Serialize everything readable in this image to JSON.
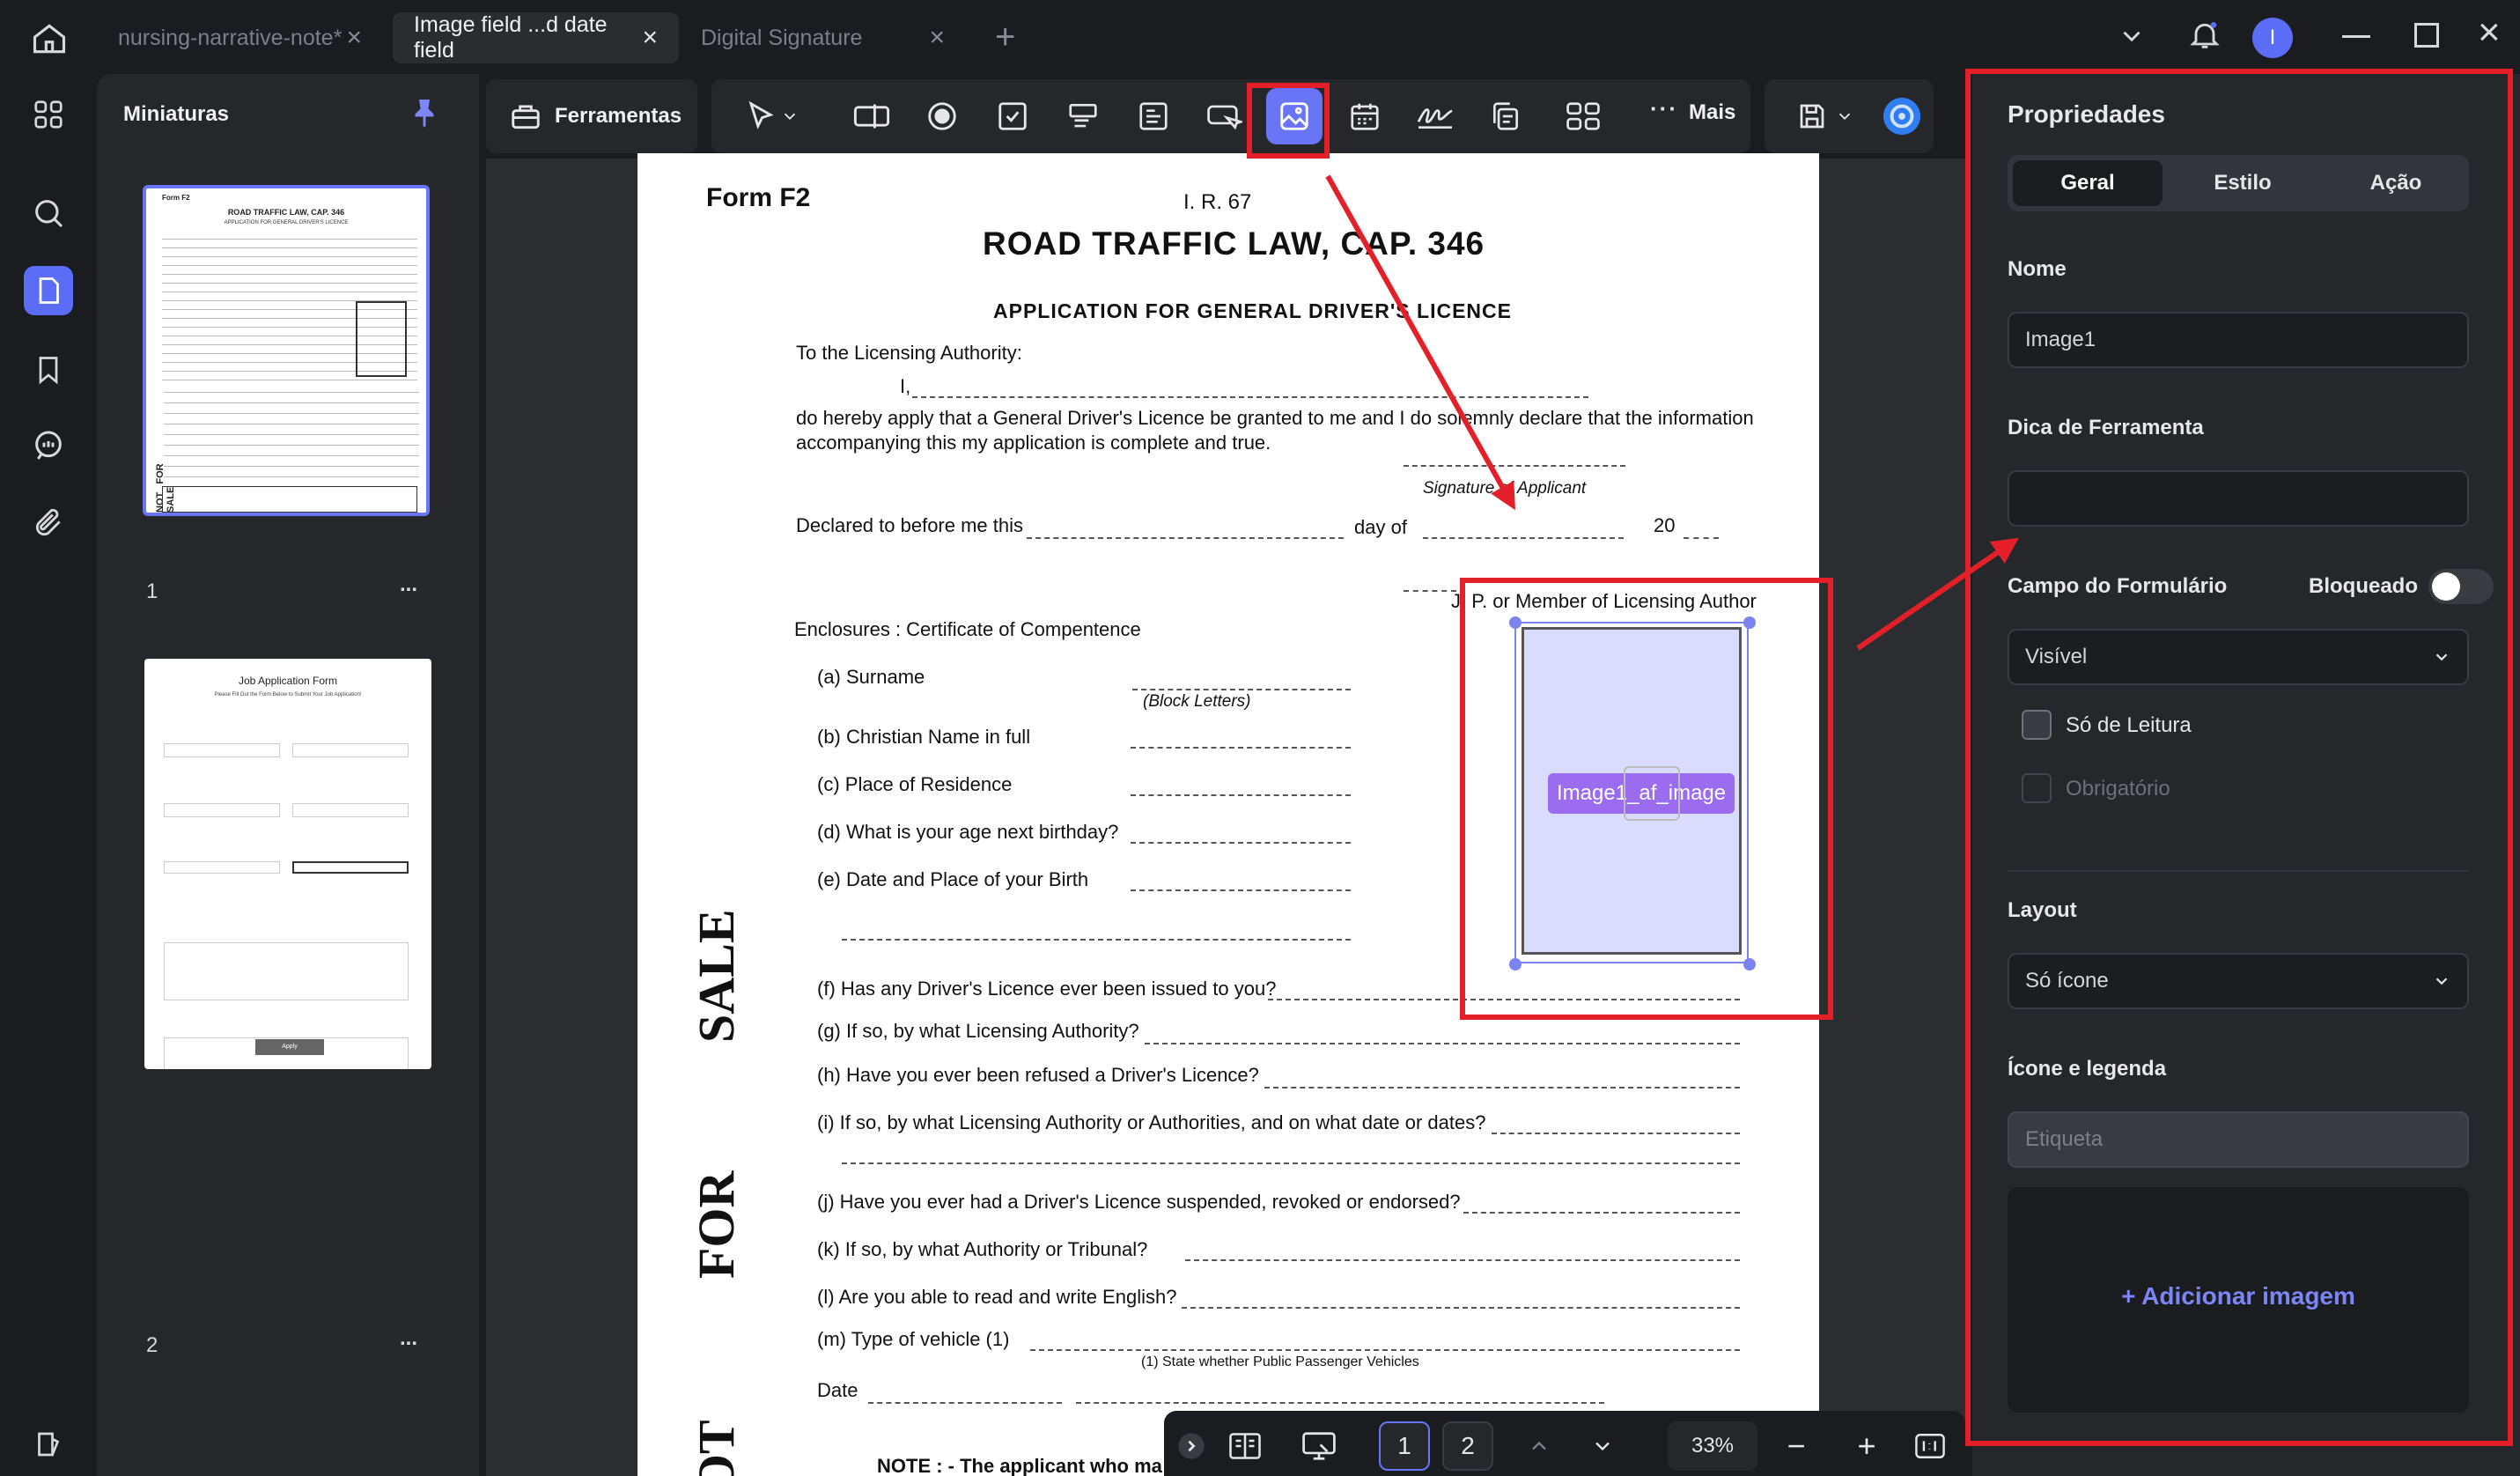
{
  "tabs": [
    {
      "label": "nursing-narrative-note*"
    },
    {
      "label": "Image field ...d date field"
    },
    {
      "label": "Digital Signature"
    }
  ],
  "window": {
    "avatar_letter": "I"
  },
  "thumbnails": {
    "title": "Miniaturas",
    "pages": [
      {
        "number": "1",
        "more": "..."
      },
      {
        "number": "2",
        "more": "..."
      }
    ],
    "job_form": {
      "title": "Job Application Form",
      "subtitle": "Please Fill Out the Form Below to Submit Your Job Application!",
      "apply": "Apply"
    }
  },
  "toolbar": {
    "tools_label": "Ferramentas",
    "more_label": "Mais"
  },
  "document": {
    "form_id": "Form F2",
    "ref": "I. R. 67",
    "title": "ROAD TRAFFIC LAW, CAP. 346",
    "subtitle": "APPLICATION FOR GENERAL DRIVER'S LICENCE",
    "to": "To the Licensing Authority:",
    "i": "I,",
    "declare": "do hereby apply that a General Driver's Licence be granted to me and I do solemnly declare that the information",
    "declare2": "accompanying this my application is complete and true.",
    "sig": "Signature of Applicant",
    "declared": "Declared to before me this",
    "dayof": "day of",
    "year": "20",
    "jp": "J. P. or Member of Licensing Author",
    "enclosures": "Enclosures :  Certificate of Compentence",
    "items": [
      "(a)  Surname",
      "(b)  Christian Name in full",
      "(c)  Place of Residence",
      "(d)  What is your age next birthday?",
      "(e)  Date and Place of your Birth",
      "(f)  Has any Driver's Licence ever been issued to you?",
      "(g)  If so, by what Licensing Authority?",
      "(h)  Have you ever been refused a Driver's Licence?",
      "(i)  If so, by what Licensing Authority or Authorities, and on what date or dates?",
      "(j)  Have you ever had a Driver's Licence suspended, revoked or endorsed?",
      "(k)  If so, by what Authority or Tribunal?",
      "(l)  Are you able to read and write English?",
      "(m)  Type of vehicle (1)",
      "Date"
    ],
    "block_letters": "(Block Letters)",
    "state_note": "(1) State whether Public Passenger Vehicles",
    "note": "NOTE : - The applicant who ma",
    "side_text": [
      "NOT",
      "FOR",
      "SALE"
    ],
    "image_field_label": "Image1_af_image"
  },
  "pager": {
    "page1": "1",
    "page2": "2",
    "zoom": "33%"
  },
  "properties": {
    "title": "Propriedades",
    "tabs": [
      "Geral",
      "Estilo",
      "Ação"
    ],
    "name_label": "Nome",
    "name_value": "Image1",
    "tooltip_label": "Dica de Ferramenta",
    "tooltip_value": "",
    "form_field_label": "Campo do Formulário",
    "locked_label": "Bloqueado",
    "visibility_value": "Visível",
    "readonly_label": "Só de Leitura",
    "required_label": "Obrigatório",
    "layout_label": "Layout",
    "layout_value": "Só ícone",
    "icon_caption_label": "Ícone e legenda",
    "caption_placeholder": "Etiqueta",
    "add_image": "+ Adicionar imagem"
  },
  "colors": {
    "accent": "#5b6cf6",
    "highlight": "#e3202a",
    "field_fill": "#d9dcfd"
  }
}
